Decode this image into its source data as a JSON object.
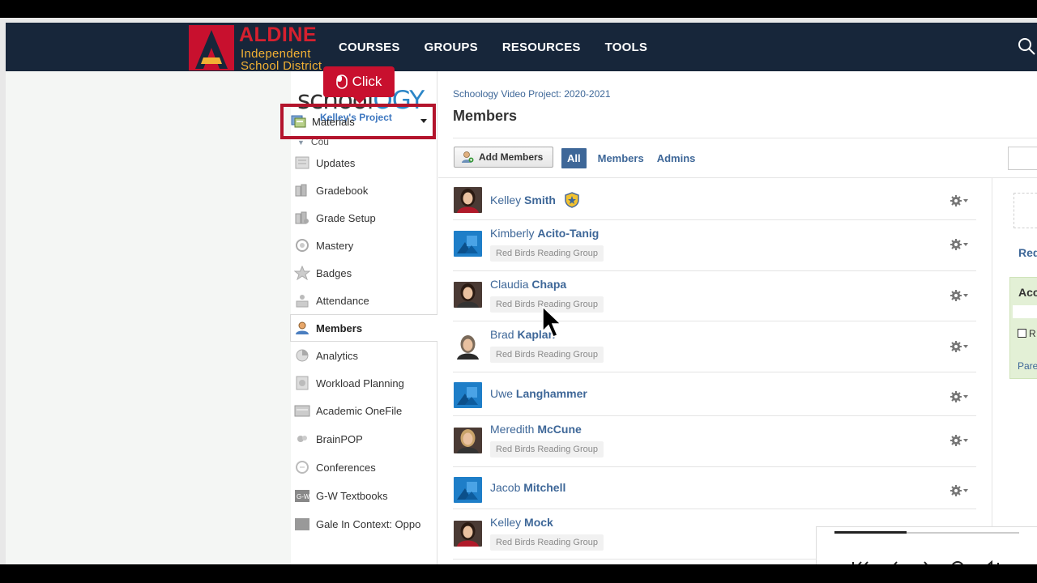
{
  "header": {
    "district_name": "ALDINE",
    "district_line2": "Independent",
    "district_line3": "School District",
    "nav": [
      "COURSES",
      "GROUPS",
      "RESOURCES",
      "TOOLS"
    ]
  },
  "sidebar": {
    "logo_text_a": "school",
    "logo_text_b": "OGY",
    "logo_sub": "Kelley's Project",
    "course_label": "Cou",
    "materials_label": "Materials",
    "items": [
      {
        "label": "Updates",
        "icon": "updates-icon"
      },
      {
        "label": "Gradebook",
        "icon": "gradebook-icon"
      },
      {
        "label": "Grade Setup",
        "icon": "grade-setup-icon"
      },
      {
        "label": "Mastery",
        "icon": "mastery-icon"
      },
      {
        "label": "Badges",
        "icon": "badge-icon"
      },
      {
        "label": "Attendance",
        "icon": "attendance-icon"
      },
      {
        "label": "Members",
        "icon": "members-icon"
      },
      {
        "label": "Analytics",
        "icon": "analytics-icon"
      },
      {
        "label": "Workload Planning",
        "icon": "workload-icon"
      },
      {
        "label": "Academic OneFile",
        "icon": "onefile-icon"
      },
      {
        "label": "BrainPOP",
        "icon": "brainpop-icon"
      },
      {
        "label": "Conferences",
        "icon": "conferences-icon"
      },
      {
        "label": "G-W Textbooks",
        "icon": "textbooks-icon"
      },
      {
        "label": "Gale In Context: Oppo",
        "icon": "gale-icon"
      }
    ]
  },
  "tooltip": {
    "label": "Click"
  },
  "main": {
    "breadcrumb": "Schoology Video Project: 2020-2021",
    "title": "Members",
    "add_members_label": "Add Members",
    "filter_tabs": [
      "All",
      "Members",
      "Admins"
    ],
    "members": [
      {
        "first": "Kelley",
        "last": "Smith",
        "group": "",
        "admin": true
      },
      {
        "first": "Kimberly",
        "last": "Acito-Tanig",
        "group": "Red Birds Reading Group",
        "admin": false
      },
      {
        "first": "Claudia",
        "last": "Chapa",
        "group": "Red Birds Reading Group",
        "admin": false
      },
      {
        "first": "Brad",
        "last": "Kaplan",
        "group": "Red Birds Reading Group",
        "admin": false
      },
      {
        "first": "Uwe",
        "last": "Langhammer",
        "group": "",
        "admin": false
      },
      {
        "first": "Meredith",
        "last": "McCune",
        "group": "Red Birds Reading Group",
        "admin": false
      },
      {
        "first": "Jacob",
        "last": "Mitchell",
        "group": "",
        "admin": false
      },
      {
        "first": "Kelley",
        "last": "Mock",
        "group": "Red Birds Reading Group",
        "admin": false
      }
    ]
  },
  "right_panel": {
    "link_text": "Red",
    "box_title": "Acc",
    "checkbox_label": "R",
    "parent_link": "Pare"
  },
  "video": {
    "progress": 0.39
  },
  "colors": {
    "nav_bg": "#17263a",
    "accent_red": "#c8102e",
    "link_blue": "#3e6798"
  }
}
